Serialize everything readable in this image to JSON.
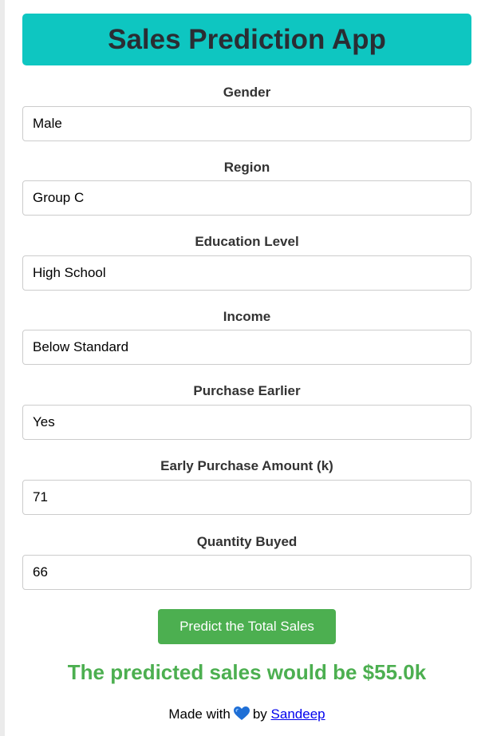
{
  "app": {
    "title": "Sales Prediction App"
  },
  "form": {
    "fields": [
      {
        "label": "Gender",
        "value": "Male"
      },
      {
        "label": "Region",
        "value": "Group C"
      },
      {
        "label": "Education Level",
        "value": "High School"
      },
      {
        "label": "Income",
        "value": "Below Standard"
      },
      {
        "label": "Purchase Earlier",
        "value": "Yes"
      },
      {
        "label": "Early Purchase Amount (k)",
        "value": "71"
      },
      {
        "label": "Quantity Buyed",
        "value": "66"
      }
    ],
    "submit_label": "Predict the Total Sales"
  },
  "result": {
    "text": "The predicted sales would be $55.0k"
  },
  "footer": {
    "prefix": "Made with",
    "heart_icon": "blue-heart-icon",
    "by": "by",
    "author": "Sandeep"
  },
  "colors": {
    "header_bg": "#0ec6c1",
    "accent_green": "#4caf50",
    "link": "#0000ee"
  }
}
